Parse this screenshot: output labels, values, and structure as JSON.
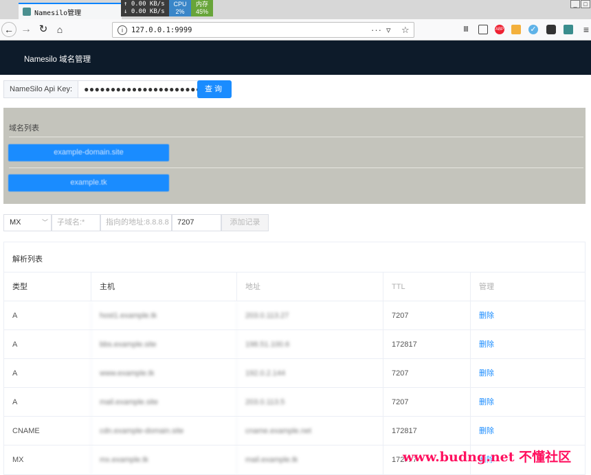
{
  "browser": {
    "tab_title": "Namesilo管理",
    "net_up": "0.00 KB/s",
    "net_down": "0.00 KB/s",
    "cpu_label": "CPU",
    "cpu_value": "2%",
    "mem_label": "内存",
    "mem_value": "45%",
    "url": "127.0.0.1:9999"
  },
  "app": {
    "title": "Namesilo 域名管理"
  },
  "api": {
    "label": "NameSilo Api Key:",
    "value": "●●●●●●●●●●●●●●●●●●●●●●",
    "query_button": "查询"
  },
  "domains": {
    "title": "域名列表",
    "items": [
      {
        "label": "example-domain.site"
      },
      {
        "label": "example.tk"
      }
    ]
  },
  "record_form": {
    "type_value": "MX",
    "subdomain_placeholder": "子域名:*",
    "address_placeholder": "指向的地址:8.8.8.8",
    "ttl_value": "7207",
    "add_button": "添加记录"
  },
  "records": {
    "title": "解析列表",
    "columns": [
      "类型",
      "主机",
      "地址",
      "TTL",
      "管理"
    ],
    "rows": [
      {
        "type": "A",
        "host": "host1.example.tk",
        "address": "203.0.113.27",
        "ttl": "7207",
        "action": "删除"
      },
      {
        "type": "A",
        "host": "bbs.example.site",
        "address": "198.51.100.6",
        "ttl": "172817",
        "action": "删除"
      },
      {
        "type": "A",
        "host": "www.example.tk",
        "address": "192.0.2.144",
        "ttl": "7207",
        "action": "删除"
      },
      {
        "type": "A",
        "host": "mail.example.site",
        "address": "203.0.113.5",
        "ttl": "7207",
        "action": "删除"
      },
      {
        "type": "CNAME",
        "host": "cdn.example-domain.site",
        "address": "cname.example.net",
        "ttl": "172817",
        "action": "删除"
      },
      {
        "type": "MX",
        "host": "mx.example.tk",
        "address": "mail.example.tk",
        "ttl": "172817",
        "action": "删除"
      }
    ]
  },
  "watermark": "www.budng.net 不懂社区"
}
